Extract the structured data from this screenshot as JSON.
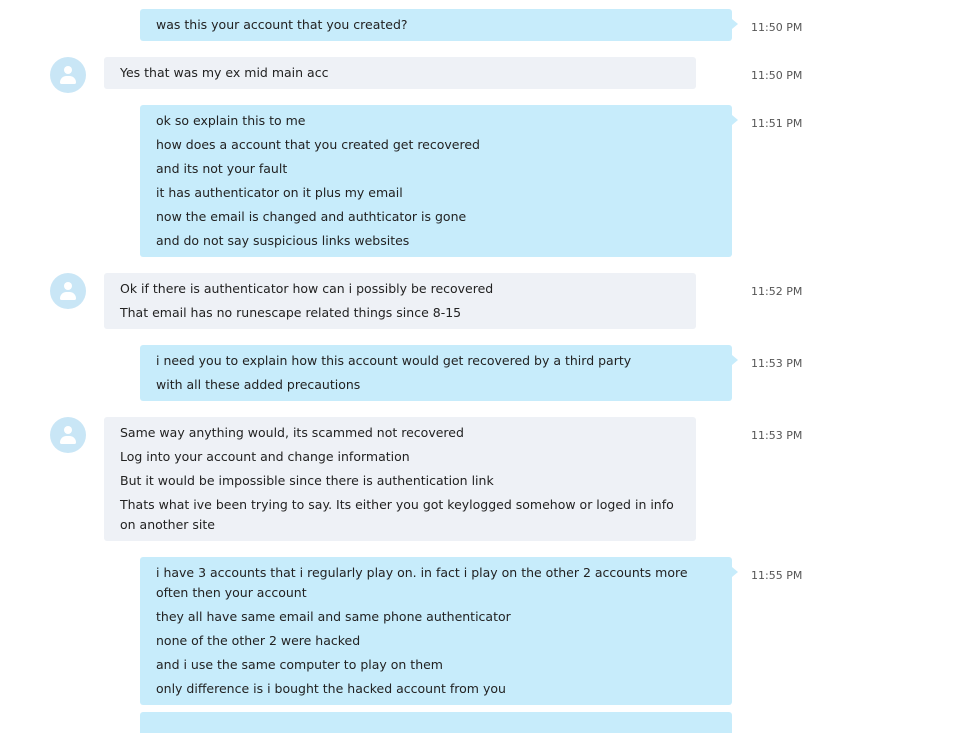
{
  "messages": [
    {
      "from": "me",
      "time": "11:50 PM",
      "lines": [
        "was this your account that you created?"
      ]
    },
    {
      "from": "them",
      "time": "11:50 PM",
      "lines": [
        "Yes that was my ex mid main acc"
      ]
    },
    {
      "from": "me",
      "time": "11:51 PM",
      "lines": [
        "ok so explain this to me",
        "how does a account that you created get recovered",
        "and its not your fault",
        "it has authenticator on it plus my email",
        "now the email is changed and authticator is gone",
        "and do not say suspicious links websites"
      ]
    },
    {
      "from": "them",
      "time": "11:52 PM",
      "lines": [
        "Ok if there is authenticator how can i possibly be recovered",
        "That email has no runescape related things since 8-15"
      ]
    },
    {
      "from": "me",
      "time": "11:53 PM",
      "lines": [
        "i need you to explain how this account would get recovered by a third party",
        "with all these added precautions"
      ]
    },
    {
      "from": "them",
      "time": "11:53 PM",
      "lines": [
        "Same way anything would, its scammed not recovered",
        "Log into your account and change information",
        "But it would be impossible since there is authentication link",
        "Thats what ive been trying to say. Its either you got keylogged somehow or loged in info on another site"
      ]
    },
    {
      "from": "me",
      "time": "11:55 PM",
      "lines": [
        "i have 3 accounts that i regularly play on. in fact i play on the other 2 accounts more often then your account",
        "they all have same email and same phone authenticator",
        "none of the other 2 were hacked",
        "and i use the same computer to play on them",
        "only difference is i bought the hacked account from you"
      ]
    }
  ],
  "icons": {
    "avatar": "user-avatar-icon"
  }
}
